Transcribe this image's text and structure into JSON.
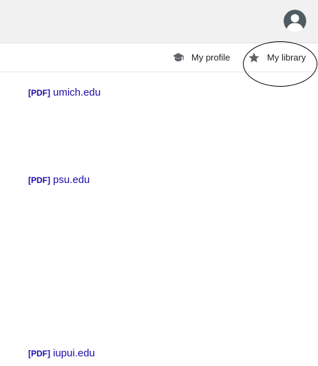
{
  "header": {
    "avatar_icon": "account-avatar-icon"
  },
  "nav": {
    "profile_label": "My profile",
    "profile_icon": "graduation-cap-icon",
    "library_label": "My library",
    "library_icon": "star-icon"
  },
  "results": [
    {
      "tag": "[PDF]",
      "source": "umich.edu"
    },
    {
      "tag": "[PDF]",
      "source": "psu.edu"
    },
    {
      "tag": "[PDF]",
      "source": "iupui.edu"
    }
  ],
  "colors": {
    "link": "#1a0dab",
    "topbar_bg": "#f1f1f1",
    "avatar": "#4f5b62",
    "icon_gray": "#5f6368"
  }
}
